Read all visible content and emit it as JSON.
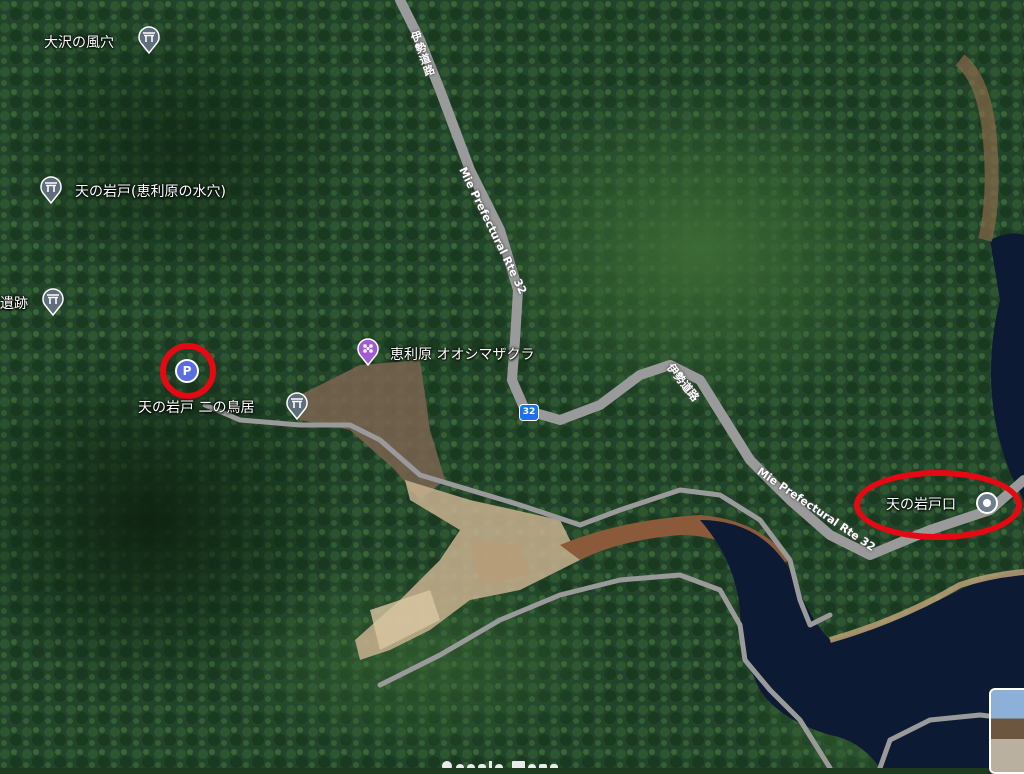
{
  "map": {
    "type": "satellite",
    "watermark": "Google Maps",
    "colors": {
      "forest": "#1f4021",
      "road": "#9a9a9a",
      "water": "#0d1a33",
      "highlight": "#e50914",
      "parking": "#5a6ee0",
      "attraction": "#a35bd4"
    }
  },
  "places": [
    {
      "id": "ozawa",
      "label": "大沢の風穴",
      "icon": "torii-icon"
    },
    {
      "id": "amanoiwato-erihara",
      "label": "天の岩戸(恵利原の水穴)",
      "icon": "torii-icon"
    },
    {
      "id": "iseki",
      "label": "遺跡",
      "icon": "torii-icon"
    },
    {
      "id": "parking",
      "label": "P",
      "icon": "parking-icon"
    },
    {
      "id": "niinotorii",
      "label": "天の岩戸 二の鳥居",
      "icon": "torii-icon"
    },
    {
      "id": "sakura",
      "label": "恵利原 オオシマザクラ",
      "icon": "flower-icon"
    },
    {
      "id": "iwatoguchi",
      "label": "天の岩戸口",
      "icon": "dot-pin-icon"
    }
  ],
  "roads": {
    "ise_road_label": "伊勢道路",
    "pref_route_label": "Mie Prefectural Rte 32",
    "route_number": "32"
  }
}
